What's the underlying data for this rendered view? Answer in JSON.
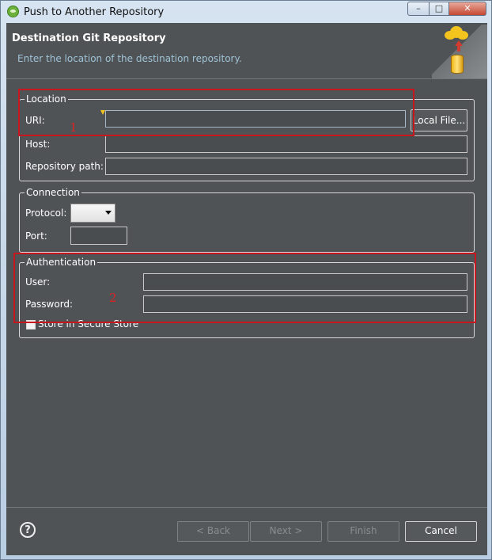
{
  "window": {
    "title": "Push to Another Repository",
    "controls": {
      "minimize": "–",
      "maximize": "□",
      "close": "✕"
    }
  },
  "header": {
    "title": "Destination Git Repository",
    "description": "Enter the location of the destination repository."
  },
  "location": {
    "group_label": "Location",
    "uri_label": "URI:",
    "uri_value": "",
    "local_file_button": "Local File...",
    "host_label": "Host:",
    "host_value": "",
    "repo_path_label": "Repository path:",
    "repo_path_value": ""
  },
  "connection": {
    "group_label": "Connection",
    "protocol_label": "Protocol:",
    "protocol_value": "",
    "port_label": "Port:",
    "port_value": ""
  },
  "authentication": {
    "group_label": "Authentication",
    "user_label": "User:",
    "user_value": "",
    "password_label": "Password:",
    "password_value": "",
    "store_label": "Store in Secure Store"
  },
  "annotations": {
    "first": "1",
    "second": "2"
  },
  "footer": {
    "help_icon": "?",
    "back_button": "< Back",
    "next_button": "Next >",
    "finish_button": "Finish",
    "cancel_button": "Cancel"
  },
  "colors": {
    "background": "#4f5356",
    "annotation_red": "#c8161e",
    "header_desc": "#9fc3d6"
  },
  "icons": [
    "app-icon",
    "cloud-push-icon",
    "help-icon",
    "required-field-icon"
  ]
}
